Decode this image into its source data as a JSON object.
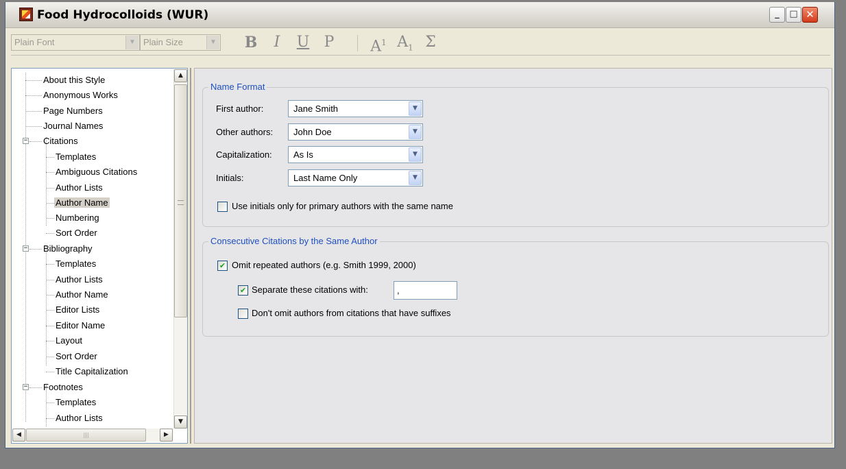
{
  "window": {
    "title": "Food Hydrocolloids (WUR)"
  },
  "title_buttons": {
    "minimize": "_",
    "maximize": "□",
    "close": "✕"
  },
  "toolbar": {
    "font": "Plain Font",
    "size": "Plain Size",
    "bold": "B",
    "italic": "I",
    "underline": "U",
    "plain": "P",
    "superscript": "A",
    "superscript_mark": "1",
    "subscript": "A",
    "subscript_mark": "1",
    "symbol": "Σ"
  },
  "tree": {
    "items": [
      {
        "label": "About this Style"
      },
      {
        "label": "Anonymous Works"
      },
      {
        "label": "Page Numbers"
      },
      {
        "label": "Journal Names"
      },
      {
        "label": "Citations"
      },
      {
        "label": "Templates"
      },
      {
        "label": "Ambiguous Citations"
      },
      {
        "label": "Author Lists"
      },
      {
        "label": "Author Name"
      },
      {
        "label": "Numbering"
      },
      {
        "label": "Sort Order"
      },
      {
        "label": "Bibliography"
      },
      {
        "label": "Templates"
      },
      {
        "label": "Author Lists"
      },
      {
        "label": "Author Name"
      },
      {
        "label": "Editor Lists"
      },
      {
        "label": "Editor Name"
      },
      {
        "label": "Layout"
      },
      {
        "label": "Sort Order"
      },
      {
        "label": "Title Capitalization"
      },
      {
        "label": "Footnotes"
      },
      {
        "label": "Templates"
      },
      {
        "label": "Author Lists"
      }
    ],
    "selected": "Author Name"
  },
  "name_format": {
    "legend": "Name Format",
    "first_author": {
      "label": "First author:",
      "value": "Jane Smith"
    },
    "other_authors": {
      "label": "Other authors:",
      "value": "John Doe"
    },
    "capitalization": {
      "label": "Capitalization:",
      "value": "As Is"
    },
    "initials": {
      "label": "Initials:",
      "value": "Last Name Only"
    },
    "use_initials": {
      "label": "Use initials only for primary authors with the same name",
      "checked": false
    }
  },
  "consecutive": {
    "legend": "Consecutive Citations by the Same Author",
    "omit_repeated": {
      "label": "Omit repeated authors (e.g. Smith 1999, 2000)",
      "checked": true
    },
    "separate": {
      "label": "Separate these citations with:",
      "checked": true,
      "value": ","
    },
    "dont_omit": {
      "label": "Don't omit authors from citations that have suffixes",
      "checked": false
    }
  },
  "colors": {
    "legend": "#1f4fbf",
    "check": "#21a121",
    "pane_bg": "#e6e6e8"
  },
  "icons": [
    "app-icon",
    "minimize-icon",
    "maximize-icon",
    "close-icon",
    "chevron-down-icon",
    "scroll-up-icon",
    "scroll-down-icon",
    "scroll-left-icon",
    "scroll-right-icon",
    "checkmark-icon"
  ]
}
